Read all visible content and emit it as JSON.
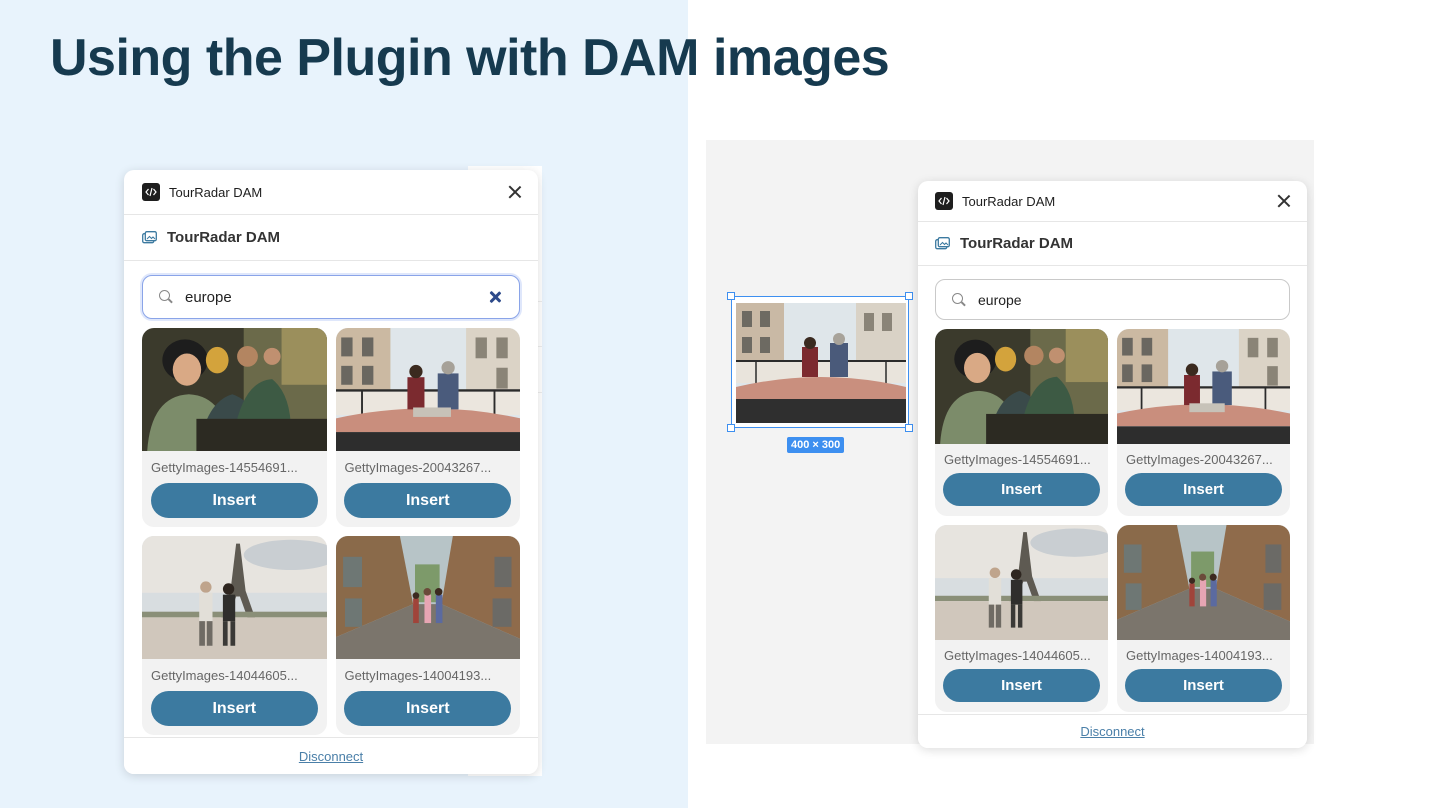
{
  "slide": {
    "title": "Using the Plugin with DAM images"
  },
  "canvas": {
    "selection_dimensions": "400 × 300"
  },
  "panels": [
    {
      "id": "left",
      "titlebar_title": "TourRadar DAM",
      "header_title": "TourRadar DAM",
      "search_value": "europe",
      "search_focused": true,
      "images": [
        {
          "name": "GettyImages-14554691...",
          "insert_label": "Insert",
          "scene": "friends"
        },
        {
          "name": "GettyImages-20043267...",
          "insert_label": "Insert",
          "scene": "venice"
        },
        {
          "name": "GettyImages-14044605...",
          "insert_label": "Insert",
          "scene": "paris"
        },
        {
          "name": "GettyImages-14004193...",
          "insert_label": "Insert",
          "scene": "street"
        }
      ],
      "footer_link": "Disconnect"
    },
    {
      "id": "right",
      "titlebar_title": "TourRadar DAM",
      "header_title": "TourRadar DAM",
      "search_value": "europe",
      "search_focused": false,
      "images": [
        {
          "name": "GettyImages-14554691...",
          "insert_label": "Insert",
          "scene": "friends"
        },
        {
          "name": "GettyImages-20043267...",
          "insert_label": "Insert",
          "scene": "venice"
        },
        {
          "name": "GettyImages-14044605...",
          "insert_label": "Insert",
          "scene": "paris"
        },
        {
          "name": "GettyImages-14004193...",
          "insert_label": "Insert",
          "scene": "street"
        }
      ],
      "footer_link": "Disconnect"
    }
  ],
  "colors": {
    "title": "#163a4f",
    "left_background": "#e8f3fc",
    "insert_button": "#3c7aa0",
    "selection": "#3d8ff0",
    "link": "#4a7fa8"
  }
}
